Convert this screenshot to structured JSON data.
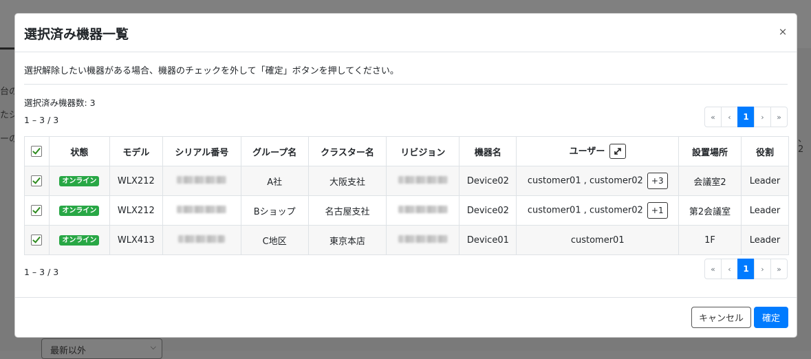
{
  "background": {
    "fragments": [
      "台の",
      "たジ",
      "ーの",
      "、2"
    ],
    "select_value": "最新以外"
  },
  "modal": {
    "title": "選択済み機器一覧",
    "close_label": "×",
    "instruction": "選択解除したい機器がある場合、機器のチェックを外して「確定」ボタンを押してください。",
    "selected_count": "選択済み機器数: 3",
    "range_top": "1 – 3 / 3",
    "range_bottom": "1 – 3 / 3",
    "pagination": {
      "first": "«",
      "prev": "‹",
      "current": "1",
      "next": "›",
      "last": "»"
    },
    "table": {
      "headers": {
        "status": "状態",
        "model": "モデル",
        "serial": "シリアル番号",
        "group": "グループ名",
        "cluster": "クラスター名",
        "revision": "リビジョン",
        "device": "機器名",
        "user": "ユーザー",
        "location": "設置場所",
        "role": "役割"
      },
      "rows": [
        {
          "status": "オンライン",
          "model": "WLX212",
          "group": "A社",
          "cluster": "大阪支社",
          "device": "Device02",
          "user": "customer01 , customer02",
          "more": "+3",
          "location": "会議室2",
          "role": "Leader"
        },
        {
          "status": "オンライン",
          "model": "WLX212",
          "group": "Bショップ",
          "cluster": "名古屋支社",
          "device": "Device02",
          "user": "customer01 , customer02",
          "more": "+1",
          "location": "第2会議室",
          "role": "Leader"
        },
        {
          "status": "オンライン",
          "model": "WLX413",
          "group": "C地区",
          "cluster": "東京本店",
          "device": "Device01",
          "user": "customer01",
          "more": "",
          "location": "1F",
          "role": "Leader"
        }
      ]
    },
    "footer": {
      "cancel_label": "キャンセル",
      "confirm_label": "確定"
    }
  },
  "colors": {
    "primary": "#007bff",
    "online_badge": "#28a745",
    "overlay": "#7a7a7a"
  }
}
